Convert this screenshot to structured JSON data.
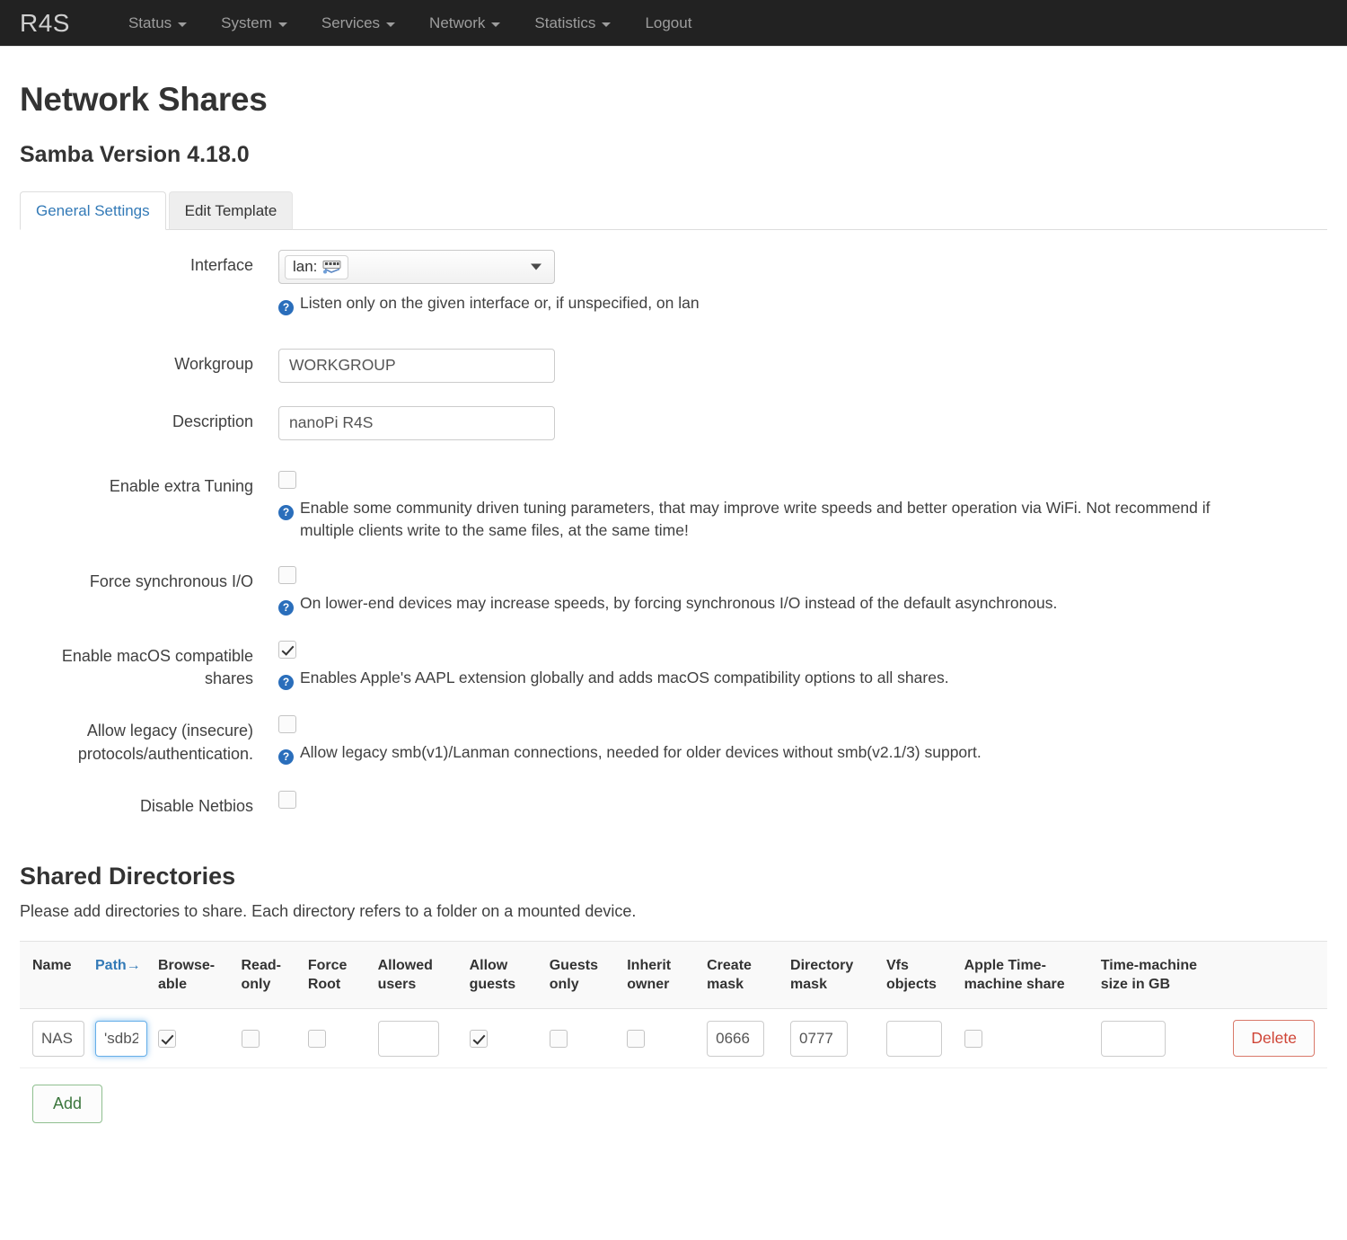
{
  "navbar": {
    "brand": "R4S",
    "items": [
      {
        "label": "Status",
        "has_caret": true
      },
      {
        "label": "System",
        "has_caret": true
      },
      {
        "label": "Services",
        "has_caret": true
      },
      {
        "label": "Network",
        "has_caret": true
      },
      {
        "label": "Statistics",
        "has_caret": true
      },
      {
        "label": "Logout",
        "has_caret": false
      }
    ]
  },
  "page": {
    "title": "Network Shares",
    "subtitle": "Samba Version 4.18.0"
  },
  "tabs": [
    {
      "label": "General Settings",
      "active": true
    },
    {
      "label": "Edit Template",
      "active": false
    }
  ],
  "general_settings": {
    "interface": {
      "label": "Interface",
      "selected_value": "lan:",
      "icon": "ethernet-network-icon",
      "hint": "Listen only on the given interface or, if unspecified, on lan"
    },
    "workgroup": {
      "label": "Workgroup",
      "value": "WORKGROUP",
      "placeholder": ""
    },
    "description": {
      "label": "Description",
      "value": "nanoPi R4S",
      "placeholder": ""
    },
    "extra_tuning": {
      "label": "Enable extra Tuning",
      "checked": false,
      "hint": "Enable some community driven tuning parameters, that may improve write speeds and better operation via WiFi. Not recommend if multiple clients write to the same files, at the same time!"
    },
    "force_sync_io": {
      "label": "Force synchronous I/O",
      "checked": false,
      "hint": "On lower-end devices may increase speeds, by forcing synchronous I/O instead of the default asynchronous."
    },
    "macos_shares": {
      "label": "Enable macOS compatible shares",
      "checked": true,
      "hint": "Enables Apple's AAPL extension globally and adds macOS compatibility options to all shares."
    },
    "legacy_protocols": {
      "label": "Allow legacy (insecure) protocols/authentication.",
      "checked": false,
      "hint": "Allow legacy smb(v1)/Lanman connections, needed for older devices without smb(v2.1/3) support."
    },
    "disable_netbios": {
      "label": "Disable Netbios",
      "checked": false
    }
  },
  "shared_directories": {
    "title": "Shared Directories",
    "description": "Please add directories to share. Each directory refers to a folder on a mounted device.",
    "columns": [
      "Name",
      "Path→",
      "Browse-able",
      "Read-only",
      "Force Root",
      "Allowed users",
      "Allow guests",
      "Guests only",
      "Inherit owner",
      "Create mask",
      "Directory mask",
      "Vfs objects",
      "Apple Time-machine share",
      "Time-machine size in GB"
    ],
    "rows": [
      {
        "name": "NAS",
        "path": "'sdb2",
        "browseable": true,
        "readonly": false,
        "force_root": false,
        "allowed_users": "",
        "allow_guests": true,
        "guests_only": false,
        "inherit_owner": false,
        "create_mask": "0666",
        "directory_mask": "0777",
        "vfs_objects": "",
        "apple_timemachine_share": false,
        "timemachine_size_gb": "",
        "delete_label": "Delete"
      }
    ],
    "add_label": "Add"
  },
  "colors": {
    "navbar_bg": "#222222",
    "link": "#337ab7",
    "hint_icon": "#2a6ebb",
    "delete": "#cf4436",
    "add": "#3c763d",
    "focus_ring": "#66afe9"
  }
}
